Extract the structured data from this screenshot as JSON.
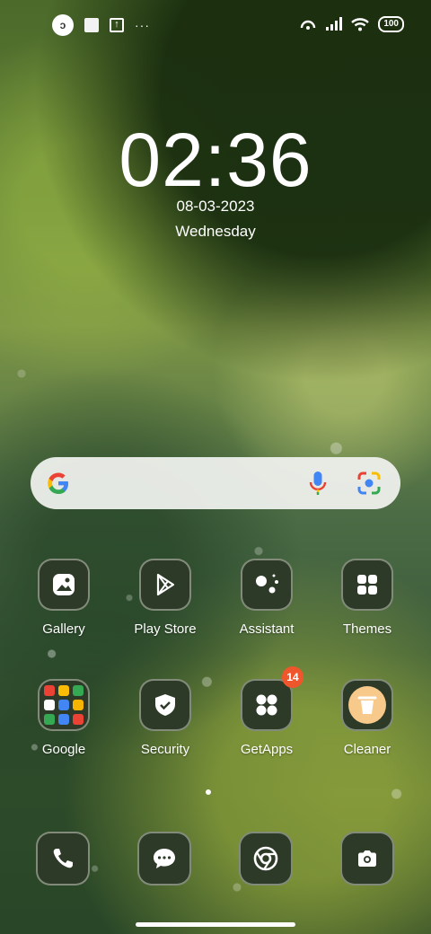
{
  "status_bar": {
    "left_icons": [
      "notification-app-icon",
      "square-notification-icon",
      "upload-icon"
    ],
    "more_indicator": "···",
    "battery_level": "100",
    "right_icons": [
      "hotspot-icon",
      "signal-icon",
      "wifi-icon",
      "battery-icon"
    ]
  },
  "clock": {
    "time": "02:36",
    "date": "08-03-2023",
    "day": "Wednesday"
  },
  "search_bar": {
    "icons": [
      "google-logo-icon",
      "microphone-icon",
      "google-lens-icon"
    ]
  },
  "apps": [
    {
      "label": "Gallery",
      "icon": "gallery-icon"
    },
    {
      "label": "Play Store",
      "icon": "play-store-icon"
    },
    {
      "label": "Assistant",
      "icon": "assistant-icon"
    },
    {
      "label": "Themes",
      "icon": "themes-icon"
    },
    {
      "label": "Google",
      "icon": "google-folder-icon"
    },
    {
      "label": "Security",
      "icon": "shield-icon"
    },
    {
      "label": "GetApps",
      "icon": "getapps-icon",
      "badge": "14"
    },
    {
      "label": "Cleaner",
      "icon": "trash-icon"
    }
  ],
  "dock": [
    {
      "icon": "phone-icon"
    },
    {
      "icon": "messages-icon"
    },
    {
      "icon": "chrome-icon"
    },
    {
      "icon": "camera-icon"
    }
  ],
  "colors": {
    "icon_bg": "#2d3a28",
    "badge": "#f0562c",
    "cleaner_accent": "#f7c98a"
  }
}
